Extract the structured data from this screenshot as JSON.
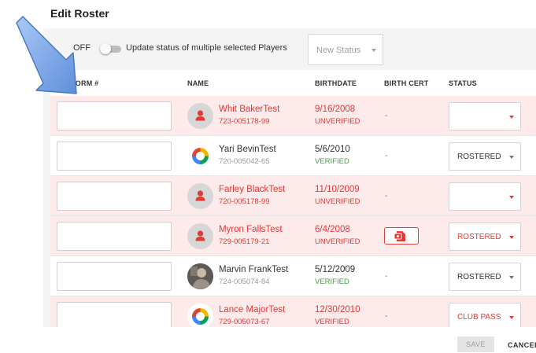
{
  "page": {
    "title": "Edit Roster"
  },
  "toolbar": {
    "toggle_state": "OFF",
    "toggle_label": "Update status of multiple selected Players",
    "new_status_placeholder": "New Status"
  },
  "table": {
    "headers": {
      "uniform": "UNIFORM #",
      "name": "NAME",
      "birthdate": "BIRTHDATE",
      "birth_cert": "BIRTH CERT",
      "status": "STATUS"
    },
    "rows": [
      {
        "name": "Whit BakerTest",
        "id": "723-005178-99",
        "birthdate": "9/16/2008",
        "verification": "UNVERIFIED",
        "birth_cert": "-",
        "status": "",
        "avatar": "person-icon",
        "invalid": true
      },
      {
        "name": "Yari BevinTest",
        "id": "720-005042-65",
        "birthdate": "5/6/2010",
        "verification": "VERIFIED",
        "birth_cert": "-",
        "status": "ROSTERED",
        "avatar": "club-logo",
        "invalid": false
      },
      {
        "name": "Farley BlackTest",
        "id": "720-005178-99",
        "birthdate": "11/10/2009",
        "verification": "UNVERIFIED",
        "birth_cert": "-",
        "status": "",
        "avatar": "person-icon",
        "invalid": true
      },
      {
        "name": "Myron FallsTest",
        "id": "729-005179-21",
        "birthdate": "6/4/2008",
        "verification": "UNVERIFIED",
        "birth_cert": "document-icon",
        "status": "ROSTERED",
        "avatar": "person-icon",
        "invalid": true
      },
      {
        "name": "Marvin FrankTest",
        "id": "724-005074-84",
        "birthdate": "5/12/2009",
        "verification": "VERIFIED",
        "birth_cert": "-",
        "status": "ROSTERED",
        "avatar": "player-photo",
        "invalid": false
      },
      {
        "name": "Lance MajorTest",
        "id": "729-005073-67",
        "birthdate": "12/30/2010",
        "verification": "VERIFIED",
        "birth_cert": "-",
        "status": "CLUB PASS",
        "avatar": "club-logo",
        "invalid": true
      }
    ]
  },
  "footer": {
    "save_label": "SAVE",
    "cancel_label": "CANCEL"
  },
  "colors": {
    "error": "#e53935",
    "verified": "#43a047",
    "invalid_row_bg": "#fdeaea",
    "arrow": "#6d9be5"
  }
}
